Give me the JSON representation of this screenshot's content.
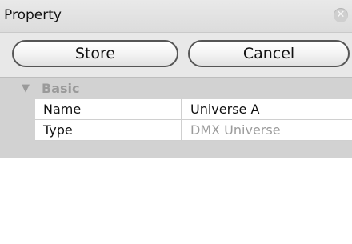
{
  "window": {
    "title": "Property"
  },
  "toolbar": {
    "store_label": "Store",
    "cancel_label": "Cancel"
  },
  "group": {
    "label": "Basic",
    "expanded": true
  },
  "properties": [
    {
      "key": "Name",
      "value": "Universe A",
      "editable": true
    },
    {
      "key": "Type",
      "value": "DMX Universe",
      "editable": false
    }
  ],
  "icons": {
    "close": "close-icon",
    "disclosure": "disclosure-triangle-icon"
  }
}
